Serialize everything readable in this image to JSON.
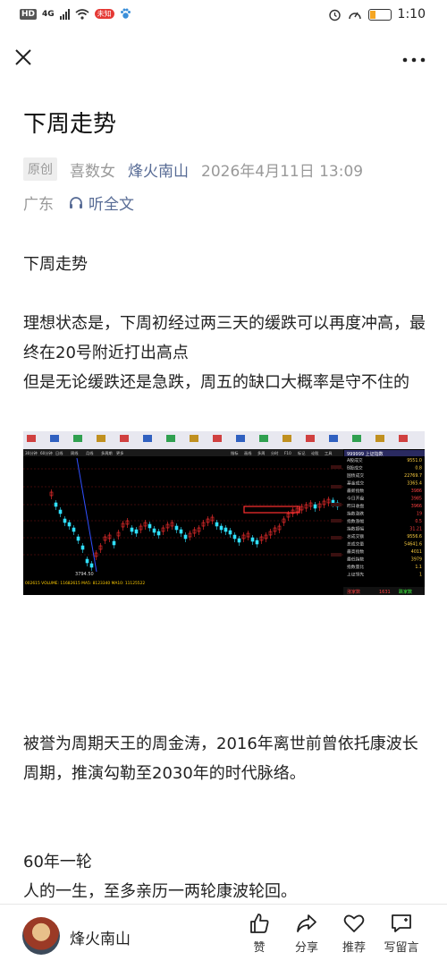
{
  "status_bar": {
    "network": "HD",
    "signal_type": "4G",
    "red_badge": "未知",
    "time": "1:10"
  },
  "article": {
    "title": "下周走势",
    "original_tag": "原创",
    "author": "喜数女",
    "account": "烽火南山",
    "date": "2026年4月11日 13:09",
    "location": "广东",
    "listen_label": "听全文",
    "paragraph1": "下周走势",
    "paragraph2_line1": "理想状态是，下周初经过两三天的缓跌可以再度冲高，最终在20号附近打出高点",
    "paragraph2_line2": "但是无论缓跌还是急跌，周五的缺口大概率是守不住的",
    "paragraph3": "被誉为周期天王的周金涛，2016年离世前曾依托康波长周期，推演勾勒至2030年的时代脉络。",
    "paragraph4_line1": "60年一轮",
    "paragraph4_line2": "人的一生，至多亲历一两轮康波轮回。"
  },
  "chart_image": {
    "panel_title": "999999 上证指数",
    "low_label": "3794.50",
    "volume_label": "002615 VOLUME: 11682615 MA5: 8123340 MA10: 11125522",
    "tabs": [
      "指标",
      "画线",
      "多周",
      "分时",
      "F10",
      "标记",
      "论股",
      "工具"
    ],
    "period_tabs": [
      "30分钟",
      "60分钟",
      "日线",
      "周线",
      "月线",
      "多周期",
      "更多"
    ],
    "right_panel": [
      {
        "label": "A股成交",
        "value": "9551.0"
      },
      {
        "label": "B股成交",
        "value": "0.8"
      },
      {
        "label": "国债成交",
        "value": "22769.7"
      },
      {
        "label": "基金成交",
        "value": "3365.4"
      },
      {
        "label": "最新指数",
        "value": "3986"
      },
      {
        "label": "今日开盘",
        "value": "3985"
      },
      {
        "label": "昨日收盘",
        "value": "3966"
      },
      {
        "label": "指数涨跌",
        "value": "19"
      },
      {
        "label": "指数涨幅",
        "value": "0.5"
      },
      {
        "label": "指数振幅",
        "value": "31.21"
      },
      {
        "label": "总成交额",
        "value": "9556.6"
      },
      {
        "label": "总成交量",
        "value": "54641.6"
      },
      {
        "label": "最高指数",
        "value": "4011"
      },
      {
        "label": "最低指数",
        "value": "3979"
      },
      {
        "label": "指数量比",
        "value": "1.1"
      },
      {
        "label": "上证领先",
        "value": "1"
      }
    ],
    "bottom_left": "涨家数",
    "bottom_mid": "1631",
    "bottom_right": "跌家数"
  },
  "bottom_bar": {
    "account_name": "烽火南山",
    "like_label": "赞",
    "share_label": "分享",
    "recommend_label": "推荐",
    "comment_label": "写留言"
  }
}
